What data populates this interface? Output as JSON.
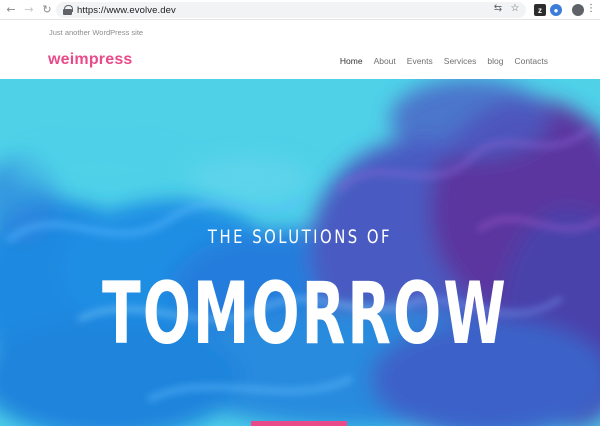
{
  "browser": {
    "url": "https://www.evolve.dev",
    "back_icon": "arrow-left-icon",
    "forward_icon": "arrow-right-icon",
    "reload_icon": "reload-icon"
  },
  "site": {
    "tagline": "Just another WordPress site",
    "logo": "weimpress",
    "brand_color": "#e94a8a",
    "nav": [
      {
        "label": "Home"
      },
      {
        "label": "About"
      },
      {
        "label": "Events"
      },
      {
        "label": "Services"
      },
      {
        "label": "blog"
      },
      {
        "label": "Contacts"
      }
    ]
  },
  "hero": {
    "subtitle": "THE SOLUTIONS OF",
    "title": "TOMORROW",
    "background_color": "#4fd1e8"
  }
}
